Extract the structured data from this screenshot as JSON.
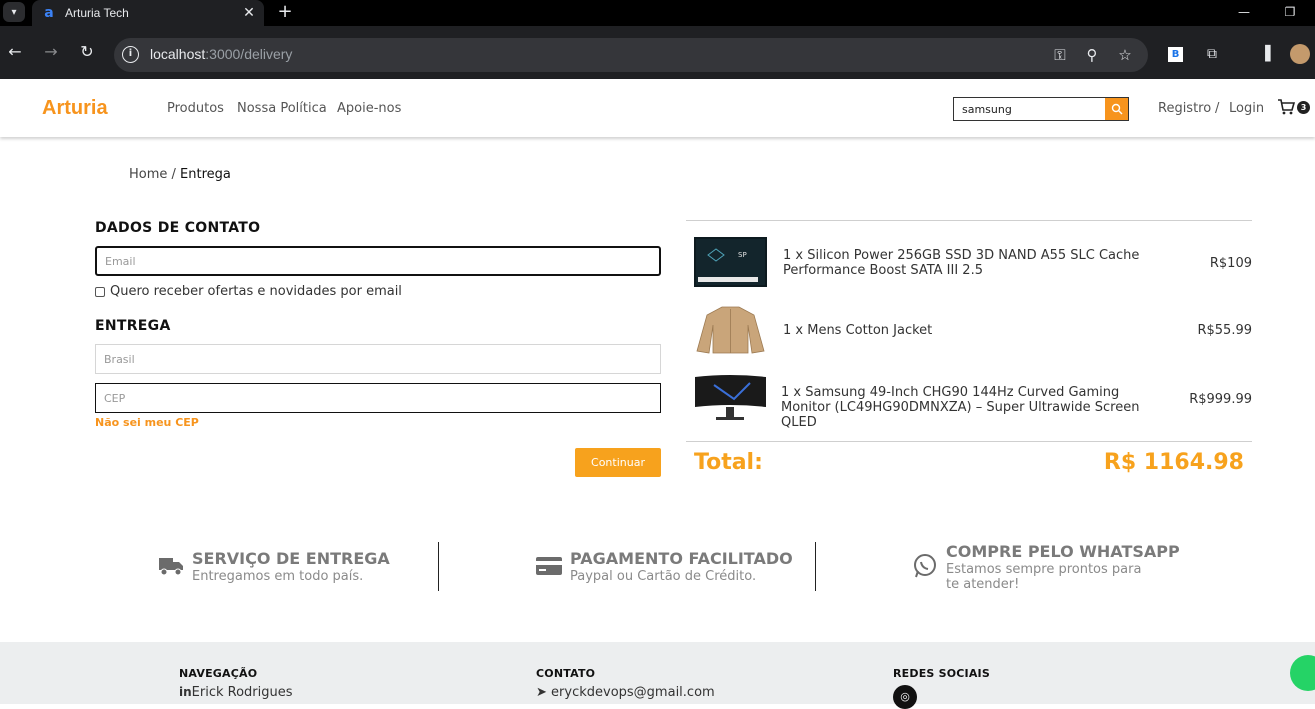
{
  "browser": {
    "tab_title": "Arturia Tech",
    "tab_close": "✕",
    "new_tab": "+",
    "url_host": "localhost",
    "url_path": ":3000/delivery",
    "ext_b_label": "B"
  },
  "header": {
    "logo": "Arturia",
    "nav": [
      "Produtos",
      "Nossa Política",
      "Apoie-nos"
    ],
    "search_value": "samsung",
    "register": "Registro",
    "separator": "/",
    "login": "Login",
    "cart_count": "3"
  },
  "breadcrumb": {
    "home": "Home",
    "separator": " / ",
    "current": "Entrega"
  },
  "contact": {
    "title": "DADOS DE CONTATO",
    "email_placeholder": "Email",
    "newsletter_label": "Quero receber ofertas e novidades por email"
  },
  "delivery": {
    "title": "ENTREGA",
    "country_placeholder": "Brasil",
    "cep_placeholder": "CEP",
    "cep_help": "Não sei meu CEP",
    "continue": "Continuar"
  },
  "order": {
    "items": [
      {
        "name": "1 x Silicon Power 256GB SSD 3D NAND A55 SLC Cache Performance Boost SATA III 2.5",
        "price": "R$109"
      },
      {
        "name": "1 x Mens Cotton Jacket",
        "price": "R$55.99"
      },
      {
        "name": "1 x Samsung 49-Inch CHG90 144Hz Curved Gaming Monitor (LC49HG90DMNXZA) – Super Ultrawide Screen QLED",
        "price": "R$999.99"
      }
    ],
    "total_label": "Total:",
    "total_value": "R$ 1164.98"
  },
  "features": [
    {
      "title": "SERVIÇO DE ENTREGA",
      "subtitle": "Entregamos em todo país.",
      "icon": "truck-icon"
    },
    {
      "title": "PAGAMENTO FACILITADO",
      "subtitle": "Paypal ou Cartão de Crédito.",
      "icon": "credit-card-icon"
    },
    {
      "title": "COMPRE PELO WHATSAPP",
      "subtitle": "Estamos sempre prontos para te atender!",
      "icon": "whatsapp-icon"
    }
  ],
  "footer": {
    "nav_title": "NAVEGAÇÃO",
    "nav_text": "Erick Rodrigues",
    "contact_title": "CONTATO",
    "contact_text": "eryckdevops@gmail.com",
    "social_title": "REDES SOCIAIS"
  },
  "colors": {
    "accent": "#f7941d",
    "button": "#f7a21d",
    "footer_bg": "#eceeef"
  }
}
